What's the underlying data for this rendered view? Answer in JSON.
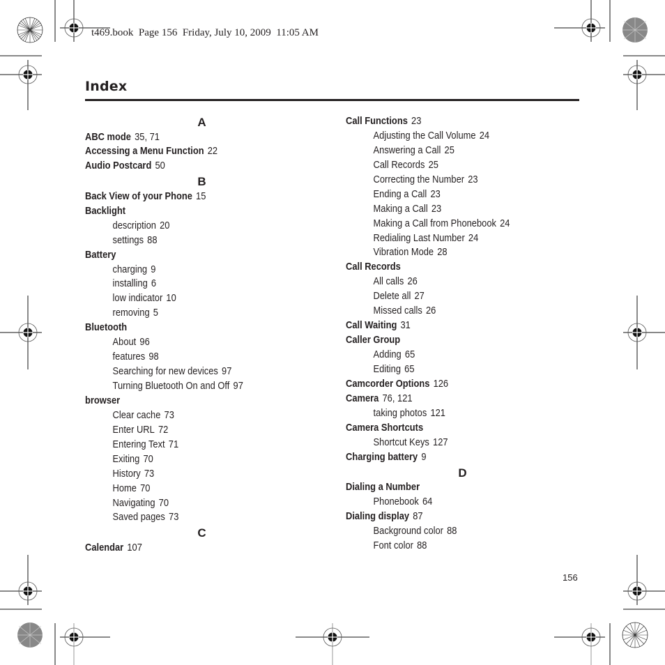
{
  "header": {
    "print_line": "t469.book  Page 156  Friday, July 10, 2009  11:05 AM"
  },
  "title": "Index",
  "left_column": [
    {
      "type": "letter",
      "text": "A"
    },
    {
      "type": "main",
      "term": "ABC mode",
      "pages": "35, 71"
    },
    {
      "type": "main",
      "term": "Accessing a Menu Function",
      "pages": "22"
    },
    {
      "type": "main",
      "term": "Audio Postcard",
      "pages": "50"
    },
    {
      "type": "letter",
      "text": "B"
    },
    {
      "type": "main",
      "term": "Back View of your Phone",
      "pages": "15"
    },
    {
      "type": "main",
      "term": "Backlight",
      "pages": ""
    },
    {
      "type": "sub",
      "term": "description",
      "pages": "20"
    },
    {
      "type": "sub",
      "term": "settings",
      "pages": "88"
    },
    {
      "type": "main",
      "term": "Battery",
      "pages": ""
    },
    {
      "type": "sub",
      "term": "charging",
      "pages": "9"
    },
    {
      "type": "sub",
      "term": "installing",
      "pages": "6"
    },
    {
      "type": "sub",
      "term": "low indicator",
      "pages": "10"
    },
    {
      "type": "sub",
      "term": "removing",
      "pages": "5"
    },
    {
      "type": "main",
      "term": "Bluetooth",
      "pages": ""
    },
    {
      "type": "sub",
      "term": "About",
      "pages": "96"
    },
    {
      "type": "sub",
      "term": "features",
      "pages": "98"
    },
    {
      "type": "sub",
      "term": "Searching for new devices",
      "pages": "97"
    },
    {
      "type": "sub",
      "term": "Turning Bluetooth On and Off",
      "pages": "97"
    },
    {
      "type": "main",
      "term": "browser",
      "pages": ""
    },
    {
      "type": "sub",
      "term": "Clear cache",
      "pages": "73"
    },
    {
      "type": "sub",
      "term": "Enter URL",
      "pages": "72"
    },
    {
      "type": "sub",
      "term": "Entering Text",
      "pages": "71"
    },
    {
      "type": "sub",
      "term": "Exiting",
      "pages": "70"
    },
    {
      "type": "sub",
      "term": "History",
      "pages": "73"
    },
    {
      "type": "sub",
      "term": "Home",
      "pages": "70"
    },
    {
      "type": "sub",
      "term": "Navigating",
      "pages": "70"
    },
    {
      "type": "sub",
      "term": "Saved pages",
      "pages": "73"
    },
    {
      "type": "letter",
      "text": "C"
    },
    {
      "type": "main",
      "term": "Calendar",
      "pages": "107"
    }
  ],
  "right_column": [
    {
      "type": "main",
      "term": "Call Functions",
      "pages": "23"
    },
    {
      "type": "sub",
      "term": "Adjusting the Call Volume",
      "pages": "24"
    },
    {
      "type": "sub",
      "term": "Answering a Call",
      "pages": "25"
    },
    {
      "type": "sub",
      "term": "Call Records",
      "pages": "25"
    },
    {
      "type": "sub",
      "term": "Correcting the Number",
      "pages": "23"
    },
    {
      "type": "sub",
      "term": "Ending a Call",
      "pages": "23"
    },
    {
      "type": "sub",
      "term": "Making a Call",
      "pages": "23"
    },
    {
      "type": "sub",
      "term": "Making a Call from Phonebook",
      "pages": "24"
    },
    {
      "type": "sub",
      "term": "Redialing Last Number",
      "pages": "24"
    },
    {
      "type": "sub",
      "term": "Vibration Mode",
      "pages": "28"
    },
    {
      "type": "main",
      "term": "Call Records",
      "pages": ""
    },
    {
      "type": "sub",
      "term": "All calls",
      "pages": "26"
    },
    {
      "type": "sub",
      "term": "Delete all",
      "pages": "27"
    },
    {
      "type": "sub",
      "term": "Missed calls",
      "pages": "26"
    },
    {
      "type": "main",
      "term": "Call Waiting",
      "pages": "31"
    },
    {
      "type": "main",
      "term": "Caller Group",
      "pages": ""
    },
    {
      "type": "sub",
      "term": "Adding",
      "pages": "65"
    },
    {
      "type": "sub",
      "term": "Editing",
      "pages": "65"
    },
    {
      "type": "main",
      "term": "Camcorder Options",
      "pages": "126"
    },
    {
      "type": "main",
      "term": "Camera",
      "pages": "76, 121"
    },
    {
      "type": "sub",
      "term": "taking photos",
      "pages": "121"
    },
    {
      "type": "main",
      "term": "Camera Shortcuts",
      "pages": ""
    },
    {
      "type": "sub",
      "term": "Shortcut Keys",
      "pages": "127"
    },
    {
      "type": "main",
      "term": "Charging battery",
      "pages": "9"
    },
    {
      "type": "letter",
      "text": "D"
    },
    {
      "type": "main",
      "term": "Dialing a Number",
      "pages": ""
    },
    {
      "type": "sub",
      "term": "Phonebook",
      "pages": "64"
    },
    {
      "type": "main",
      "term": "Dialing display",
      "pages": "87"
    },
    {
      "type": "sub",
      "term": "Background color",
      "pages": "88"
    },
    {
      "type": "sub",
      "term": "Font color",
      "pages": "88"
    }
  ],
  "page_number": "156"
}
